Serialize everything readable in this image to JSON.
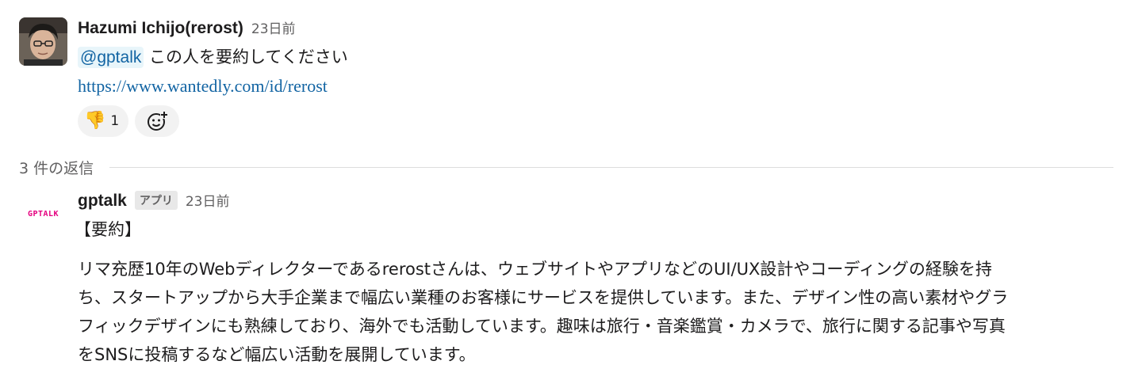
{
  "message1": {
    "author": "Hazumi Ichijo(rerost)",
    "timestamp": "23日前",
    "mention": "@gptalk",
    "text": "この人を要約してください",
    "link": "https://www.wantedly.com/id/rerost",
    "reactions": [
      {
        "emoji": "👎",
        "count": "1"
      }
    ]
  },
  "replies": {
    "label": "3 件の返信"
  },
  "message2": {
    "author": "gptalk",
    "badge": "アプリ",
    "timestamp": "23日前",
    "avatar_text": "GPTALK",
    "heading": "【要約】",
    "lines": [
      "リマ充歴10年のWebディレクターであるrerostさんは、ウェブサイトやアプリなどのUI/UX設計やコーディングの経験を持",
      "ち、スタートアップから大手企業まで幅広い業種のお客様にサービスを提供しています。また、デザイン性の高い素材やグラ",
      "フィックデザインにも熟練しており、海外でも活動しています。趣味は旅行・音楽鑑賞・カメラで、旅行に関する記事や写真",
      "をSNSに投稿するなど幅広い活動を展開しています。"
    ]
  },
  "colors": {
    "link": "#1264a3",
    "mention_bg": "#e8f5fa",
    "muted": "#616061",
    "logo": "#e5007f"
  }
}
